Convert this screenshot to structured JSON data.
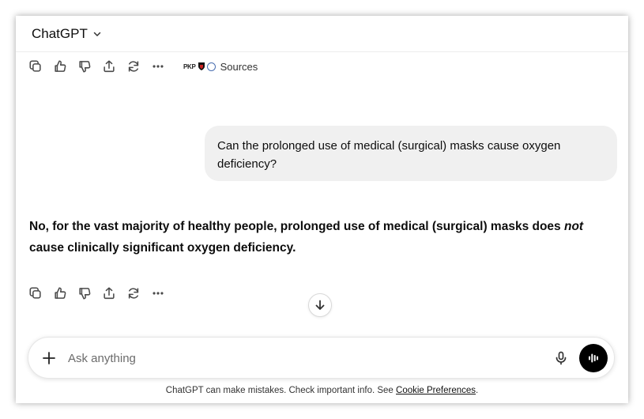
{
  "header": {
    "model_name": "ChatGPT"
  },
  "top_actions": {
    "sources_logos_text": "PKP",
    "sources_label": "Sources"
  },
  "conversation": {
    "user_message": "Can the prolonged use of medical (surgical) masks cause oxygen deficiency?",
    "answer_part1": "No, for the vast majority of healthy people, prolonged use of medical (surgical) masks does ",
    "answer_emphasis": "not",
    "answer_part2": " cause clinically significant oxygen deficiency."
  },
  "composer": {
    "placeholder": "Ask anything"
  },
  "footer": {
    "disclaimer_text": "ChatGPT can make mistakes. Check important info. See ",
    "cookie_link": "Cookie Preferences",
    "disclaimer_end": "."
  },
  "icons": {
    "copy": "copy-icon",
    "thumbs_up": "thumbs-up-icon",
    "thumbs_down": "thumbs-down-icon",
    "share": "share-icon",
    "regenerate": "regenerate-icon",
    "more": "more-icon",
    "scroll_down": "arrow-down-icon",
    "plus": "plus-icon",
    "mic": "microphone-icon",
    "voice": "voice-mode-icon"
  },
  "colors": {
    "user_bubble": "#f0f0f0",
    "voice_button": "#000000",
    "text": "#0d0d0d"
  }
}
